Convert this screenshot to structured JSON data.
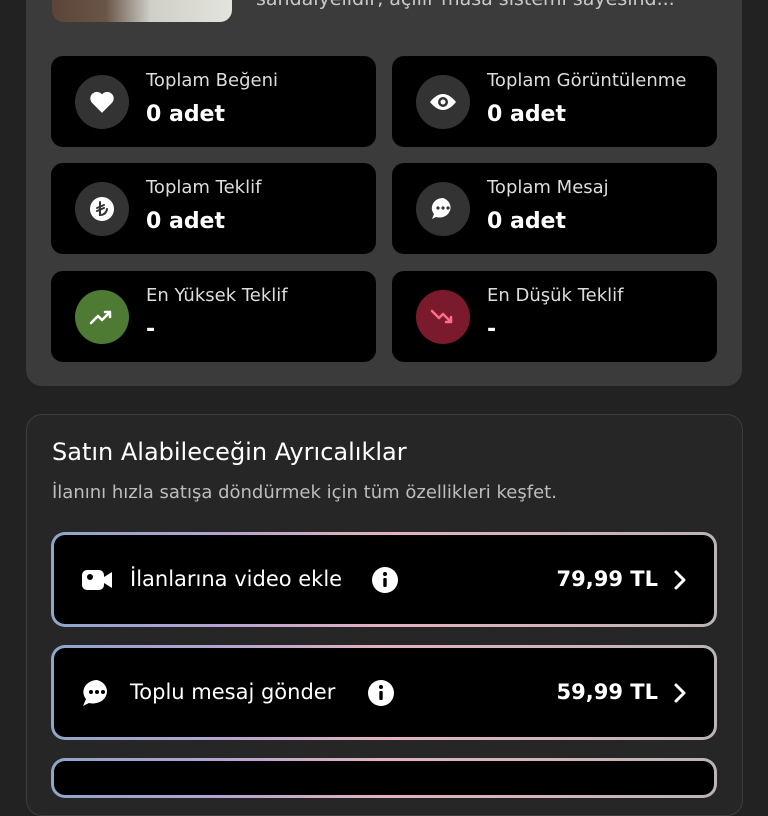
{
  "listing": {
    "description": "sandalyelidir, açılır masa sistemi sayesind..."
  },
  "stats": {
    "total_likes": {
      "label": "Toplam Beğeni",
      "value": "0 adet",
      "icon": "heart-icon"
    },
    "total_views": {
      "label": "Toplam Görüntülenme",
      "value": "0 adet",
      "icon": "eye-icon"
    },
    "total_offers": {
      "label": "Toplam Teklif",
      "value": "0 adet",
      "icon": "lira-icon"
    },
    "total_messages": {
      "label": "Toplam Mesaj",
      "value": "0 adet",
      "icon": "chat-icon"
    },
    "highest_offer": {
      "label": "En Yüksek Teklif",
      "value": "-",
      "icon": "trend-up-icon",
      "color": "#4f7a33"
    },
    "lowest_offer": {
      "label": "En Düşük Teklif",
      "value": "-",
      "icon": "trend-down-icon",
      "color": "#7a1a2c"
    }
  },
  "privileges": {
    "title": "Satın Alabileceğin Ayrıcalıklar",
    "subtitle": "İlanını hızla satışa döndürmek için tüm özellikleri keşfet.",
    "items": [
      {
        "label": "İlanlarına video ekle",
        "price": "79,99 TL",
        "icon": "video-camera-icon"
      },
      {
        "label": "Toplu mesaj gönder",
        "price": "59,99 TL",
        "icon": "chat-bubble-icon"
      }
    ]
  }
}
